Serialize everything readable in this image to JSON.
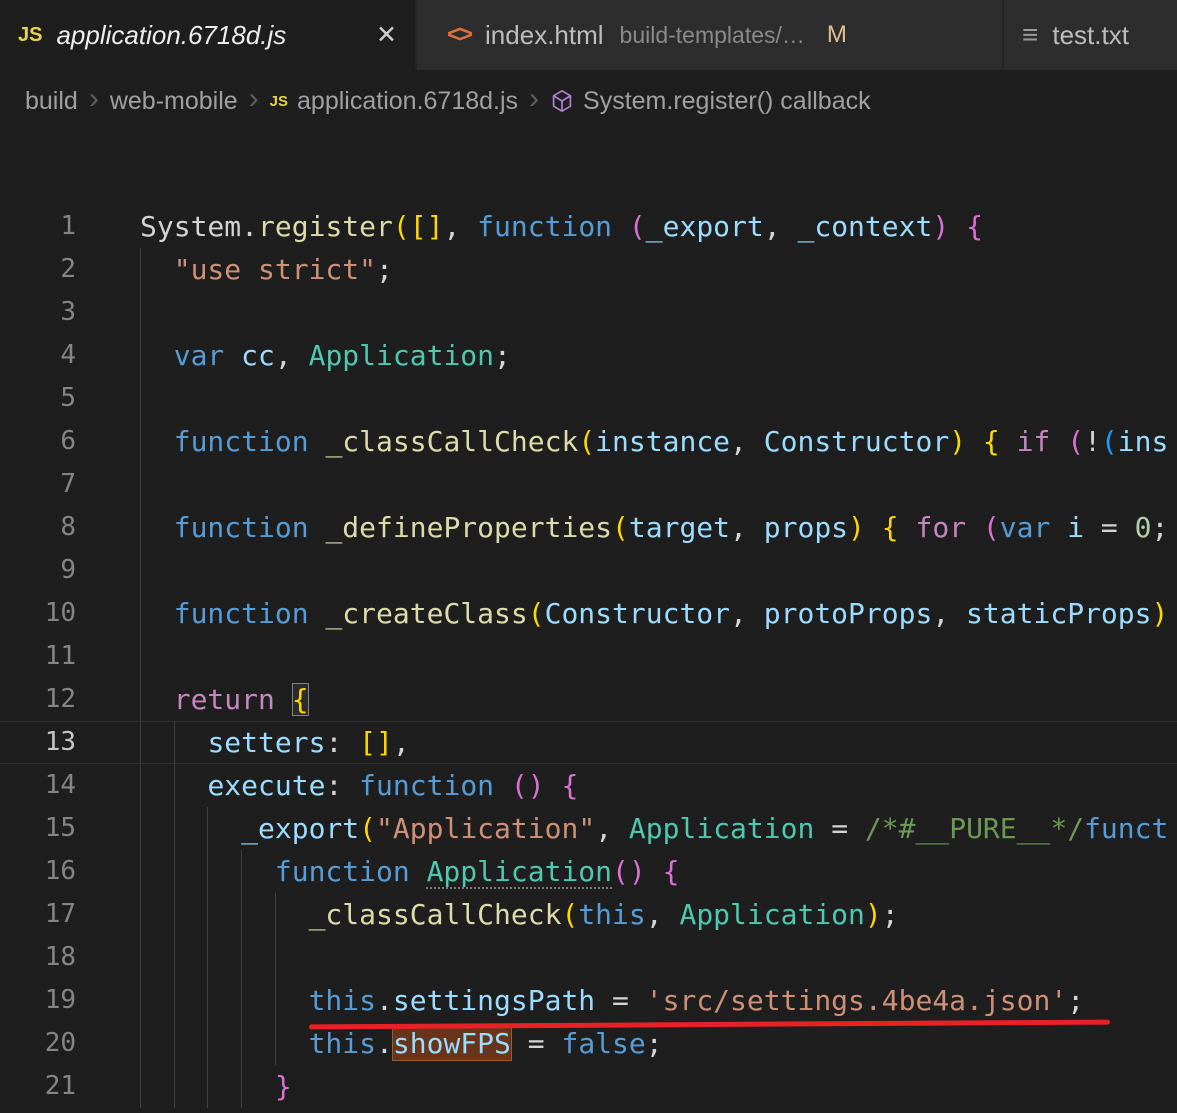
{
  "tabs": [
    {
      "title": "application.6718d.js",
      "icon": "JS",
      "close_label": "✕"
    },
    {
      "title": "index.html",
      "icon": "<>",
      "description": "build-templates/…",
      "badge": "M"
    },
    {
      "title": "test.txt",
      "icon": "≡"
    }
  ],
  "breadcrumb": {
    "separator": "›",
    "file_icon": "JS",
    "items": [
      "build",
      "web-mobile",
      "application.6718d.js",
      "System.register() callback"
    ]
  },
  "colors": {
    "annotation_red": "#e82127",
    "find_highlight_bg": "#66351c",
    "modified_badge": "#e2c08d",
    "js_icon": "#e8d44d",
    "html_icon": "#e0703a",
    "symbol_icon": "#b180d7"
  },
  "editor": {
    "palette": {
      "fg": "#d4d4d4",
      "kw": "#569cd6",
      "ctrl": "#c586c0",
      "fn": "#dcdcaa",
      "var": "#9cdcfe",
      "cls": "#4ec9b0",
      "str": "#ce9178",
      "num": "#b5cea8",
      "cmt": "#6a9955",
      "b1": "#ffd700",
      "b2": "#da70d6",
      "b3": "#179fff"
    },
    "lines": [
      {
        "n": 1,
        "ind": 0,
        "g": 0,
        "tokens": [
          [
            "System",
            "fg"
          ],
          [
            ".",
            "fg"
          ],
          [
            "register",
            "fn"
          ],
          [
            "(",
            "b1"
          ],
          [
            "[]",
            "b1"
          ],
          [
            ", ",
            "fg"
          ],
          [
            "function ",
            "kw"
          ],
          [
            "(",
            "b2"
          ],
          [
            "_export",
            "var"
          ],
          [
            ", ",
            "fg"
          ],
          [
            "_context",
            "var"
          ],
          [
            ")",
            "b2"
          ],
          [
            " ",
            "fg"
          ],
          [
            "{",
            "b2"
          ]
        ]
      },
      {
        "n": 2,
        "ind": 2,
        "g": 1,
        "tokens": [
          [
            "\"use strict\"",
            "str"
          ],
          [
            ";",
            "fg"
          ]
        ]
      },
      {
        "n": 3,
        "ind": 0,
        "g": 1,
        "tokens": []
      },
      {
        "n": 4,
        "ind": 2,
        "g": 1,
        "tokens": [
          [
            "var ",
            "kw"
          ],
          [
            "cc",
            "var"
          ],
          [
            ", ",
            "fg"
          ],
          [
            "Application",
            "cls"
          ],
          [
            ";",
            "fg"
          ]
        ]
      },
      {
        "n": 5,
        "ind": 0,
        "g": 1,
        "tokens": []
      },
      {
        "n": 6,
        "ind": 2,
        "g": 1,
        "tokens": [
          [
            "function ",
            "kw"
          ],
          [
            "_classCallCheck",
            "fn"
          ],
          [
            "(",
            "b1"
          ],
          [
            "instance",
            "var"
          ],
          [
            ", ",
            "fg"
          ],
          [
            "Constructor",
            "var"
          ],
          [
            ")",
            "b1"
          ],
          [
            " ",
            "fg"
          ],
          [
            "{ ",
            "b1"
          ],
          [
            "if ",
            "ctrl"
          ],
          [
            "(",
            "b2"
          ],
          [
            "!",
            "fg"
          ],
          [
            "(",
            "b3"
          ],
          [
            "ins",
            "var"
          ]
        ]
      },
      {
        "n": 7,
        "ind": 0,
        "g": 1,
        "tokens": []
      },
      {
        "n": 8,
        "ind": 2,
        "g": 1,
        "tokens": [
          [
            "function ",
            "kw"
          ],
          [
            "_defineProperties",
            "fn"
          ],
          [
            "(",
            "b1"
          ],
          [
            "target",
            "var"
          ],
          [
            ", ",
            "fg"
          ],
          [
            "props",
            "var"
          ],
          [
            ")",
            "b1"
          ],
          [
            " ",
            "fg"
          ],
          [
            "{ ",
            "b1"
          ],
          [
            "for ",
            "ctrl"
          ],
          [
            "(",
            "b2"
          ],
          [
            "var ",
            "kw"
          ],
          [
            "i",
            "var"
          ],
          [
            " = ",
            "fg"
          ],
          [
            "0",
            "num"
          ],
          [
            ";",
            "fg"
          ]
        ]
      },
      {
        "n": 9,
        "ind": 0,
        "g": 1,
        "tokens": []
      },
      {
        "n": 10,
        "ind": 2,
        "g": 1,
        "tokens": [
          [
            "function ",
            "kw"
          ],
          [
            "_createClass",
            "fn"
          ],
          [
            "(",
            "b1"
          ],
          [
            "Constructor",
            "var"
          ],
          [
            ", ",
            "fg"
          ],
          [
            "protoProps",
            "var"
          ],
          [
            ", ",
            "fg"
          ],
          [
            "staticProps",
            "var"
          ],
          [
            ")",
            "b1"
          ]
        ]
      },
      {
        "n": 11,
        "ind": 0,
        "g": 1,
        "tokens": []
      },
      {
        "n": 12,
        "ind": 2,
        "g": 1,
        "tokens": [
          [
            "return ",
            "ctrl"
          ],
          [
            "{",
            "b1",
            "match"
          ]
        ]
      },
      {
        "n": 13,
        "ind": 4,
        "g": 2,
        "current": true,
        "tokens": [
          [
            "setters",
            "var"
          ],
          [
            ": ",
            "fg"
          ],
          [
            "[]",
            "b1"
          ],
          [
            ",",
            "fg"
          ]
        ]
      },
      {
        "n": 14,
        "ind": 4,
        "g": 2,
        "tokens": [
          [
            "execute",
            "var"
          ],
          [
            ": ",
            "fg"
          ],
          [
            "function ",
            "kw"
          ],
          [
            "()",
            "b2"
          ],
          [
            " ",
            "fg"
          ],
          [
            "{",
            "b2"
          ]
        ]
      },
      {
        "n": 15,
        "ind": 6,
        "g": 3,
        "tokens": [
          [
            "_export",
            "var"
          ],
          [
            "(",
            "b1"
          ],
          [
            "\"Application\"",
            "str"
          ],
          [
            ", ",
            "fg"
          ],
          [
            "Application",
            "cls"
          ],
          [
            " = ",
            "fg"
          ],
          [
            "/*#__PURE__*/",
            "cmt"
          ],
          [
            "funct",
            "kw"
          ]
        ]
      },
      {
        "n": 16,
        "ind": 8,
        "g": 4,
        "tokens": [
          [
            "function ",
            "kw"
          ],
          [
            "Application",
            "cls",
            "declu"
          ],
          [
            "()",
            "b2"
          ],
          [
            " ",
            "fg"
          ],
          [
            "{",
            "b2"
          ]
        ]
      },
      {
        "n": 17,
        "ind": 10,
        "g": 5,
        "tokens": [
          [
            "_classCallCheck",
            "fn"
          ],
          [
            "(",
            "b1"
          ],
          [
            "this",
            "kw"
          ],
          [
            ", ",
            "fg"
          ],
          [
            "Application",
            "cls"
          ],
          [
            ")",
            "b1"
          ],
          [
            ";",
            "fg"
          ]
        ]
      },
      {
        "n": 18,
        "ind": 0,
        "g": 5,
        "tokens": []
      },
      {
        "n": 19,
        "ind": 10,
        "g": 5,
        "redline": {
          "start": 10,
          "width": 47.5
        },
        "tokens": [
          [
            "this",
            "kw"
          ],
          [
            ".",
            "fg"
          ],
          [
            "settingsPath",
            "var"
          ],
          [
            " = ",
            "fg"
          ],
          [
            "'src/settings.4be4a.json'",
            "str"
          ],
          [
            ";",
            "fg"
          ]
        ]
      },
      {
        "n": 20,
        "ind": 10,
        "g": 5,
        "tokens": [
          [
            "this",
            "kw"
          ],
          [
            ".",
            "fg"
          ],
          [
            "showFPS",
            "var",
            "hl"
          ],
          [
            " = ",
            "fg"
          ],
          [
            "false",
            "kw"
          ],
          [
            ";",
            "fg"
          ]
        ]
      },
      {
        "n": 21,
        "ind": 8,
        "g": 4,
        "tokens": [
          [
            "}",
            "b2"
          ]
        ]
      }
    ]
  }
}
